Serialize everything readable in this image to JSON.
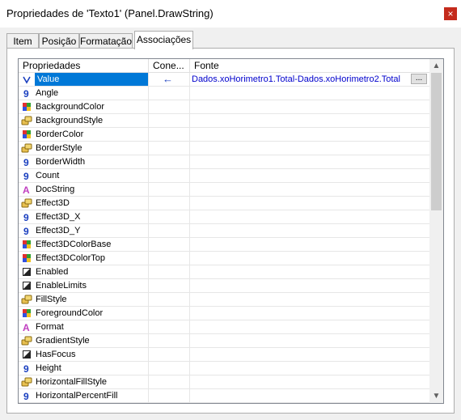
{
  "window": {
    "title": "Propriedades de 'Texto1' (Panel.DrawString)",
    "close_glyph": "×"
  },
  "tabs": [
    {
      "label": "Item"
    },
    {
      "label": "Posição"
    },
    {
      "label": "Formatação"
    },
    {
      "label": "Associações"
    }
  ],
  "grid": {
    "columns": [
      "Propriedades",
      "Cone...",
      "Fonte"
    ],
    "rows": [
      {
        "name": "Value",
        "icon": "v-icon",
        "selected": true,
        "conn": "←",
        "source": "Dados.xoHorimetro1.Total-Dados.xoHorimetro2.Total"
      },
      {
        "name": "Angle",
        "icon": "9-icon"
      },
      {
        "name": "BackgroundColor",
        "icon": "color-icon"
      },
      {
        "name": "BackgroundStyle",
        "icon": "style-icon"
      },
      {
        "name": "BorderColor",
        "icon": "color-icon"
      },
      {
        "name": "BorderStyle",
        "icon": "style-icon"
      },
      {
        "name": "BorderWidth",
        "icon": "9-icon"
      },
      {
        "name": "Count",
        "icon": "9-icon"
      },
      {
        "name": "DocString",
        "icon": "a-icon"
      },
      {
        "name": "Effect3D",
        "icon": "style-icon"
      },
      {
        "name": "Effect3D_X",
        "icon": "9-icon"
      },
      {
        "name": "Effect3D_Y",
        "icon": "9-icon"
      },
      {
        "name": "Effect3DColorBase",
        "icon": "color-icon"
      },
      {
        "name": "Effect3DColorTop",
        "icon": "color-icon"
      },
      {
        "name": "Enabled",
        "icon": "bool-icon"
      },
      {
        "name": "EnableLimits",
        "icon": "bool-icon"
      },
      {
        "name": "FillStyle",
        "icon": "style-icon"
      },
      {
        "name": "ForegroundColor",
        "icon": "color-icon"
      },
      {
        "name": "Format",
        "icon": "a-icon"
      },
      {
        "name": "GradientStyle",
        "icon": "style-icon"
      },
      {
        "name": "HasFocus",
        "icon": "bool-icon"
      },
      {
        "name": "Height",
        "icon": "9-icon"
      },
      {
        "name": "HorizontalFillStyle",
        "icon": "style-icon"
      },
      {
        "name": "HorizontalPercentFill",
        "icon": "9-icon"
      }
    ],
    "dots_label": "...",
    "scroll_up": "▲",
    "scroll_down": "▼"
  },
  "colors": {
    "selection": "#0078d7",
    "source_text": "#0000cc",
    "number_icon": "#1a3fbf",
    "text_icon": "#c03fc0"
  }
}
